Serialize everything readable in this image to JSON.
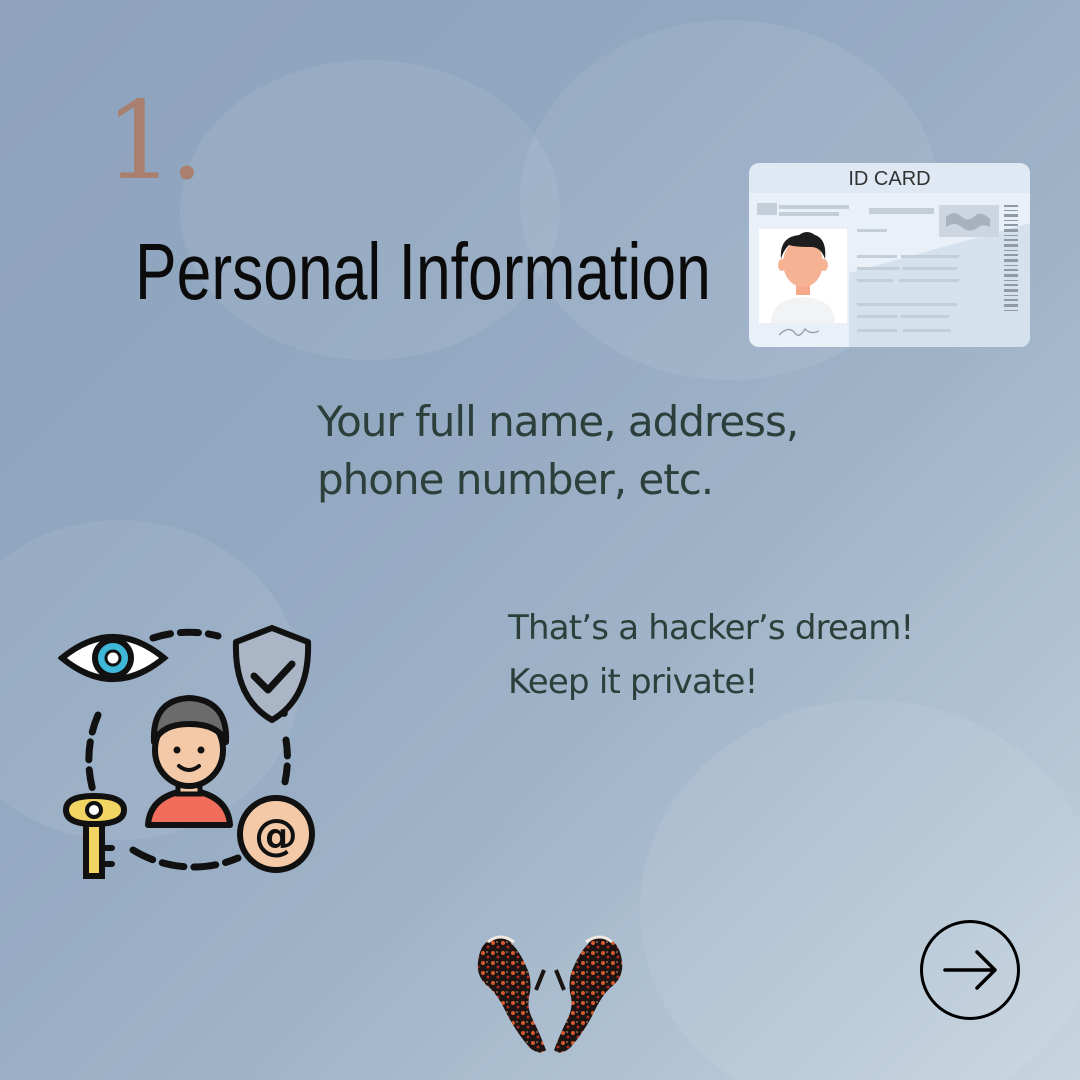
{
  "slide": {
    "number": "1.",
    "title": "Personal Information",
    "description_lines": [
      "Your full name, address,",
      "phone number, etc."
    ],
    "note_lines": [
      "That’s a hacker’s dream!",
      "Keep it private!"
    ]
  },
  "id_card": {
    "header": "ID CARD"
  },
  "icons": {
    "id_card": "id-card-icon",
    "privacy": "privacy-user-icon",
    "logo": "brand-logo",
    "next": "arrow-right-icon"
  },
  "colors": {
    "number": "#a9806f",
    "title": "#0b0b0b",
    "body_text": "#2c3f3a",
    "background": "#92a8c1"
  }
}
